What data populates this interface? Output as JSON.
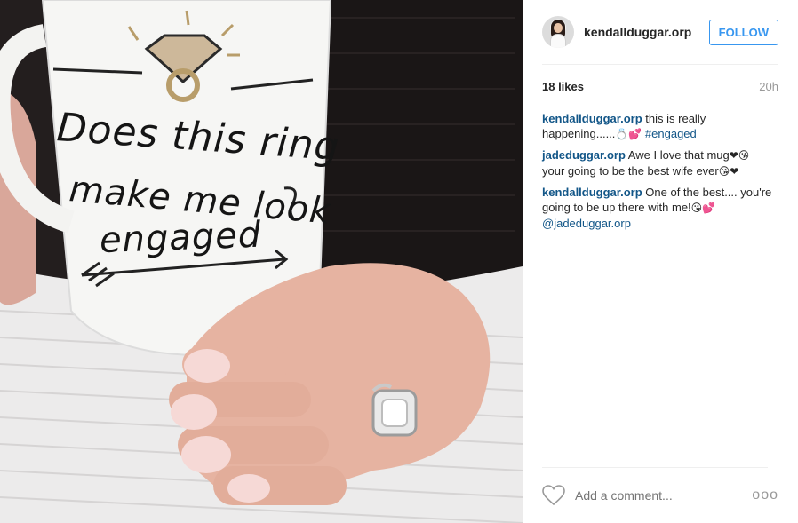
{
  "photo": {
    "mug_text": [
      "Does this ring",
      "make me look",
      "engaged"
    ]
  },
  "post": {
    "username": "kendallduggar.orp",
    "follow_label": "FOLLOW",
    "likes": "18 likes",
    "time": "20h",
    "comments": [
      {
        "user": "kendallduggar.orp",
        "text": " this is really happening......",
        "emoji": "💍💕",
        "tail": " ",
        "link": "#engaged"
      },
      {
        "user": "jadeduggar.orp",
        "text": " Awe I love that mug",
        "emoji": "❤😘",
        "tail": " your going to be the best wife ever",
        "emoji2": "😘❤"
      },
      {
        "user": "kendallduggar.orp",
        "text": " One of the best.... you're going to be up there with me!",
        "emoji": "😘💕",
        "tail": " ",
        "link": "@jadeduggar.orp"
      }
    ],
    "comment_placeholder": "Add a comment...",
    "more_label": "ooo"
  },
  "icons": [
    "heart-icon",
    "more-options-icon"
  ],
  "colors": {
    "follow_blue": "#3897f0",
    "link_blue": "#125688",
    "muted": "#999999"
  }
}
